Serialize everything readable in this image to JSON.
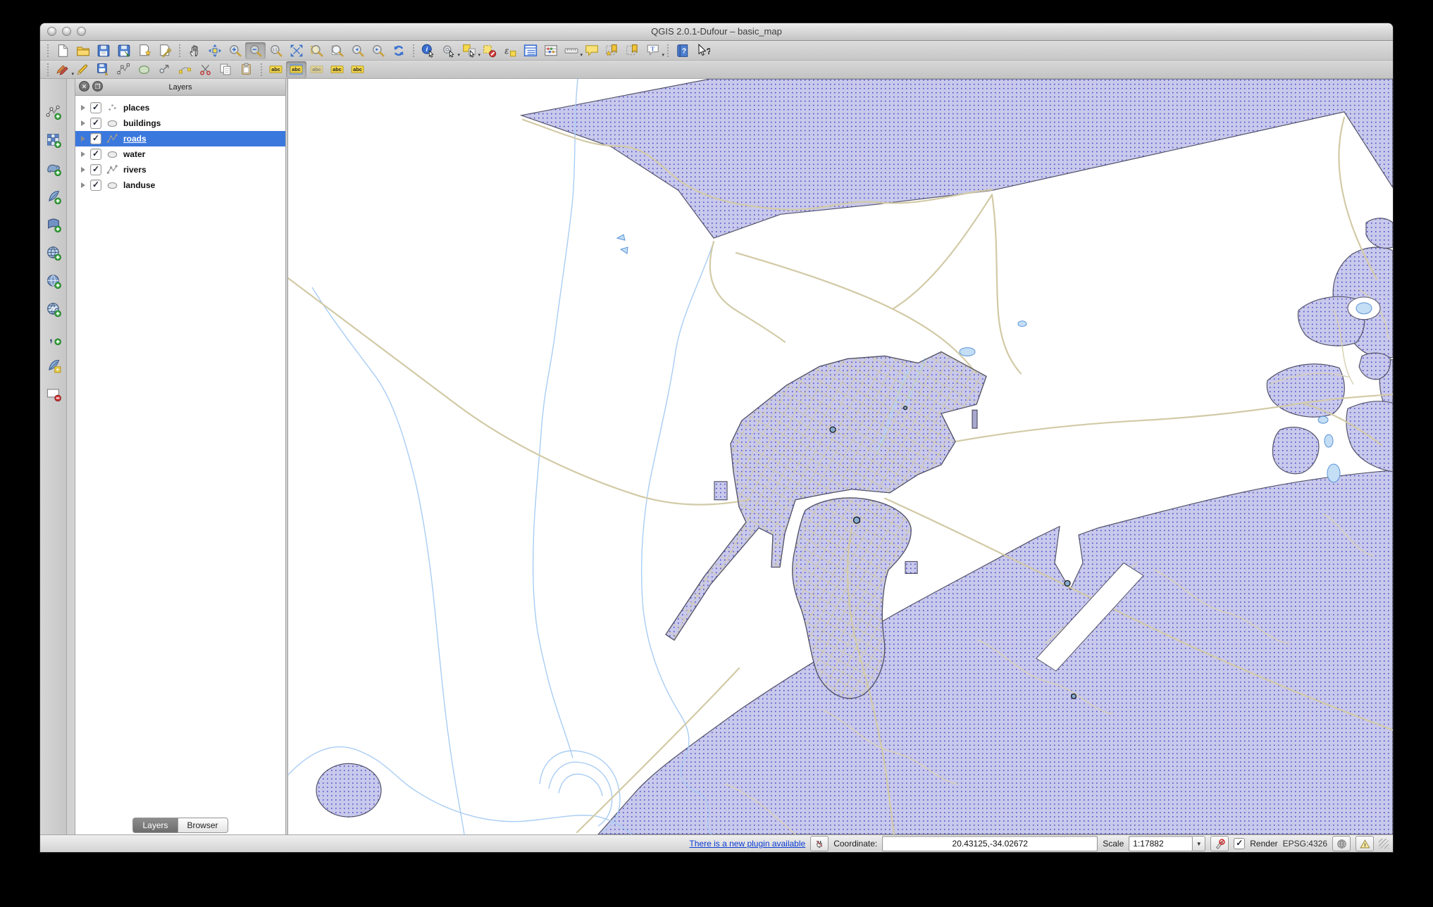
{
  "window": {
    "title": "QGIS 2.0.1-Dufour – basic_map"
  },
  "toolbar_main": [
    {
      "sep": true
    },
    {
      "n": "new-project",
      "i": "page"
    },
    {
      "n": "open-project",
      "i": "folder"
    },
    {
      "n": "save-project",
      "i": "floppy"
    },
    {
      "n": "save-project-as",
      "i": "floppy_as"
    },
    {
      "n": "new-print-composer",
      "i": "composer"
    },
    {
      "n": "composer-manager",
      "i": "composer_mgr"
    },
    {
      "sep": true
    },
    {
      "n": "pan-map",
      "i": "hand"
    },
    {
      "n": "pan-to-selection",
      "i": "move"
    },
    {
      "n": "zoom-in",
      "i": "zoom_in"
    },
    {
      "n": "zoom-out",
      "i": "zoom_out",
      "active": true
    },
    {
      "n": "zoom-native",
      "i": "zoom_native"
    },
    {
      "n": "zoom-full",
      "i": "zoom_full"
    },
    {
      "n": "zoom-to-selection",
      "i": "zoom_sel"
    },
    {
      "n": "zoom-to-layer",
      "i": "zoom_layer"
    },
    {
      "n": "zoom-last",
      "i": "zoom_last"
    },
    {
      "n": "zoom-next",
      "i": "zoom_next"
    },
    {
      "n": "refresh-map",
      "i": "refresh"
    },
    {
      "sep": true
    },
    {
      "n": "identify-features",
      "i": "identify"
    },
    {
      "n": "run-feature-action",
      "i": "action",
      "dd": true
    },
    {
      "n": "select-features",
      "i": "select",
      "dd": true
    },
    {
      "n": "deselect-features",
      "i": "deselect"
    },
    {
      "n": "select-by-expression",
      "i": "expr"
    },
    {
      "n": "open-attribute-table",
      "i": "table"
    },
    {
      "n": "field-calculator",
      "i": "abacus"
    },
    {
      "n": "measure",
      "i": "ruler",
      "dd": true
    },
    {
      "n": "map-tips",
      "i": "maptips"
    },
    {
      "n": "new-bookmark",
      "i": "bookmark_new"
    },
    {
      "n": "show-bookmarks",
      "i": "bookmark_show"
    },
    {
      "n": "text-annotation",
      "i": "annotation",
      "dd": true
    },
    {
      "sep": true
    },
    {
      "n": "help-contents",
      "i": "help"
    },
    {
      "n": "whats-this",
      "i": "whatsthis"
    }
  ],
  "toolbar_edit": [
    {
      "sep": true
    },
    {
      "n": "current-edits",
      "i": "edits2",
      "dd": true
    },
    {
      "n": "toggle-editing",
      "i": "pencil"
    },
    {
      "n": "save-layer-edits",
      "i": "save_edits"
    },
    {
      "n": "add-feature",
      "i": "addfeat"
    },
    {
      "n": "add-polygon-feature",
      "i": "addpoly"
    },
    {
      "n": "move-feature",
      "i": "movefeat"
    },
    {
      "n": "node-tool",
      "i": "nodetool"
    },
    {
      "n": "cut-features",
      "i": "scissors"
    },
    {
      "n": "copy-features",
      "i": "copy"
    },
    {
      "n": "paste-features",
      "i": "paste"
    },
    {
      "sep": true
    },
    {
      "n": "layer-labeling",
      "i": "abc"
    },
    {
      "n": "pin-labels",
      "i": "abc_pressed",
      "active": true
    },
    {
      "n": "show-hide-labels",
      "i": "abc_faded"
    },
    {
      "n": "move-label",
      "i": "abc"
    },
    {
      "n": "change-label",
      "i": "abc"
    }
  ],
  "toolbar_layers": [
    {
      "n": "add-vector-layer",
      "i": "vector"
    },
    {
      "n": "add-raster-layer",
      "i": "raster"
    },
    {
      "n": "add-postgis-layer",
      "i": "postgis"
    },
    {
      "n": "add-spatialite-layer",
      "i": "spatialite"
    },
    {
      "n": "add-mssql-layer",
      "i": "mssql"
    },
    {
      "n": "add-wms-layer",
      "i": "wms"
    },
    {
      "n": "add-wcs-layer",
      "i": "wcs"
    },
    {
      "n": "add-wfs-layer",
      "i": "wfs"
    },
    {
      "n": "add-delimited-text-layer",
      "i": "csv"
    },
    {
      "n": "new-spatialite-layer",
      "i": "newsl"
    },
    {
      "n": "remove-layer",
      "i": "removelayer"
    }
  ],
  "layers_panel": {
    "title": "Layers",
    "layers": [
      {
        "label": "places",
        "geometry": "point",
        "checked": true,
        "selected": false
      },
      {
        "label": "buildings",
        "geometry": "polygon",
        "checked": true,
        "selected": false
      },
      {
        "label": "roads",
        "geometry": "line",
        "checked": true,
        "selected": true
      },
      {
        "label": "water",
        "geometry": "polygon",
        "checked": true,
        "selected": false
      },
      {
        "label": "rivers",
        "geometry": "line",
        "checked": true,
        "selected": false
      },
      {
        "label": "landuse",
        "geometry": "polygon",
        "checked": true,
        "selected": false
      }
    ],
    "tabs": [
      {
        "label": "Layers",
        "active": true
      },
      {
        "label": "Browser",
        "active": false
      }
    ]
  },
  "status_bar": {
    "plugin_link": "There is a new plugin available",
    "coordinate_label": "Coordinate:",
    "coordinate_value": "20.43125,-34.02672",
    "scale_label": "Scale",
    "scale_value": "1:17882",
    "render_label": "Render",
    "render_checked": "✓",
    "epsg": "EPSG:4326",
    "checkmark": "✓"
  },
  "colors": {
    "selection_blue": "#3b78dd",
    "link_blue": "#0a3cd6",
    "landuse_fill": "#c9c9ec",
    "landuse_dot": "#4343c6",
    "landuse_outline": "#53536b",
    "road": "#d2caa6",
    "river": "#a9cdf4",
    "water_fill": "#c3def5",
    "map_background": "#ffffff"
  }
}
